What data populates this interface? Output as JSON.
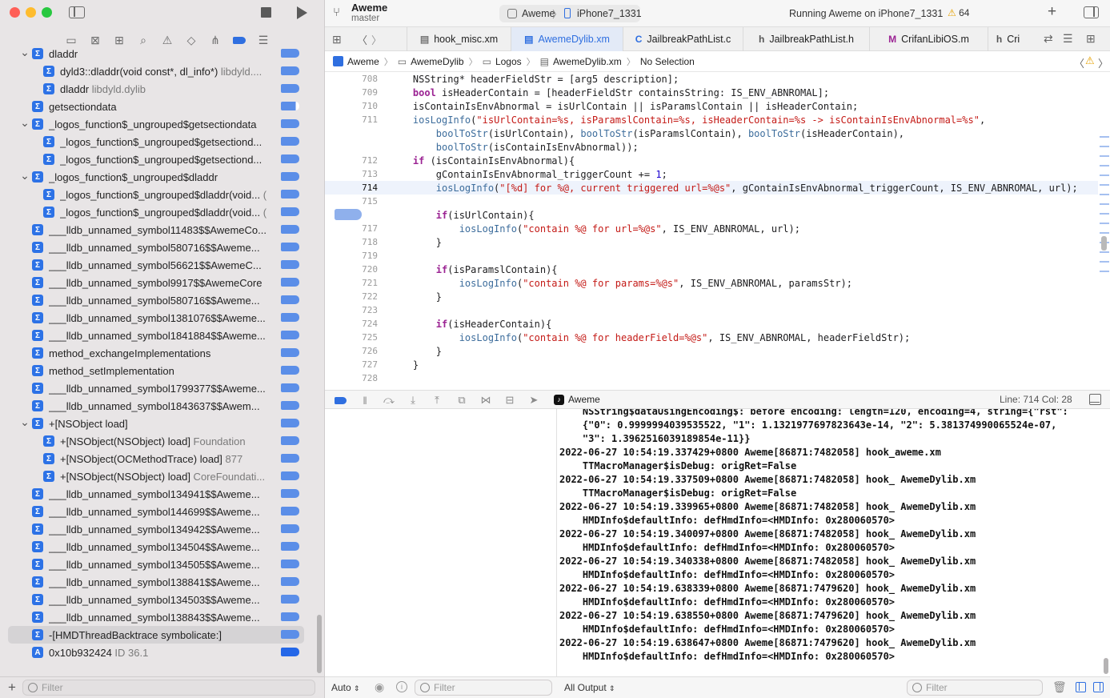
{
  "window": {
    "project_name": "Aweme",
    "branch": "master",
    "scheme": "Aweme",
    "device": "iPhone7_1331",
    "status": "Running Aweme on iPhone7_1331",
    "warning_count": "64"
  },
  "sidebar": {
    "filter_placeholder": "Filter",
    "items": [
      {
        "label": "dladdr",
        "sub": "",
        "disclosure": "v",
        "level": 0
      },
      {
        "label": "dyld3::dladdr(void const*, dl_info*)",
        "sub": "libdyld....",
        "disclosure": "",
        "level": 1
      },
      {
        "label": "dladdr",
        "sub": "libdyld.dylib",
        "disclosure": "",
        "level": 1
      },
      {
        "label": "getsectiondata",
        "sub": "",
        "disclosure": "",
        "level": 0
      },
      {
        "label": "_logos_function$_ungrouped$getsectiondata",
        "sub": "",
        "disclosure": "v",
        "level": 0
      },
      {
        "label": "_logos_function$_ungrouped$getsectiond...",
        "sub": "",
        "disclosure": "",
        "level": 1
      },
      {
        "label": "_logos_function$_ungrouped$getsectiond...",
        "sub": "",
        "disclosure": "",
        "level": 1
      },
      {
        "label": "_logos_function$_ungrouped$dladdr",
        "sub": "",
        "disclosure": "v",
        "level": 0
      },
      {
        "label": "_logos_function$_ungrouped$dladdr(void...",
        "sub": "(",
        "disclosure": "",
        "level": 1
      },
      {
        "label": "_logos_function$_ungrouped$dladdr(void...",
        "sub": "(",
        "disclosure": "",
        "level": 1
      },
      {
        "label": "___lldb_unnamed_symbol11483$$AwemeCo...",
        "sub": "",
        "disclosure": "",
        "level": 0
      },
      {
        "label": "___lldb_unnamed_symbol580716$$Aweme...",
        "sub": "",
        "disclosure": "",
        "level": 0
      },
      {
        "label": "___lldb_unnamed_symbol56621$$AwemeC...",
        "sub": "",
        "disclosure": "",
        "level": 0
      },
      {
        "label": "___lldb_unnamed_symbol9917$$AwemeCore",
        "sub": "",
        "disclosure": "",
        "level": 0
      },
      {
        "label": "___lldb_unnamed_symbol580716$$Aweme...",
        "sub": "",
        "disclosure": "",
        "level": 0
      },
      {
        "label": "___lldb_unnamed_symbol1381076$$Aweme...",
        "sub": "",
        "disclosure": "",
        "level": 0
      },
      {
        "label": "___lldb_unnamed_symbol1841884$$Aweme...",
        "sub": "",
        "disclosure": "",
        "level": 0
      },
      {
        "label": "method_exchangeImplementations",
        "sub": "",
        "disclosure": "",
        "level": 0
      },
      {
        "label": "method_setImplementation",
        "sub": "",
        "disclosure": "",
        "level": 0
      },
      {
        "label": "___lldb_unnamed_symbol1799377$$Aweme...",
        "sub": "",
        "disclosure": "",
        "level": 0
      },
      {
        "label": "___lldb_unnamed_symbol1843637$$Awem...",
        "sub": "",
        "disclosure": "",
        "level": 0
      },
      {
        "label": "+[NSObject load]",
        "sub": "",
        "disclosure": "v",
        "level": 0
      },
      {
        "label": "+[NSObject(NSObject) load]",
        "sub": "Foundation",
        "disclosure": "",
        "level": 1
      },
      {
        "label": "+[NSObject(OCMethodTrace) load]",
        "sub": "877",
        "disclosure": "",
        "level": 1
      },
      {
        "label": "+[NSObject(NSObject) load]",
        "sub": "CoreFoundati...",
        "disclosure": "",
        "level": 1
      },
      {
        "label": "___lldb_unnamed_symbol134941$$Aweme...",
        "sub": "",
        "disclosure": "",
        "level": 0
      },
      {
        "label": "___lldb_unnamed_symbol144699$$Aweme...",
        "sub": "",
        "disclosure": "",
        "level": 0
      },
      {
        "label": "___lldb_unnamed_symbol134942$$Aweme...",
        "sub": "",
        "disclosure": "",
        "level": 0
      },
      {
        "label": "___lldb_unnamed_symbol134504$$Aweme...",
        "sub": "",
        "disclosure": "",
        "level": 0
      },
      {
        "label": "___lldb_unnamed_symbol134505$$Aweme...",
        "sub": "",
        "disclosure": "",
        "level": 0
      },
      {
        "label": "___lldb_unnamed_symbol138841$$Aweme...",
        "sub": "",
        "disclosure": "",
        "level": 0
      },
      {
        "label": "___lldb_unnamed_symbol134503$$Aweme...",
        "sub": "",
        "disclosure": "",
        "level": 0
      },
      {
        "label": "___lldb_unnamed_symbol138843$$Aweme...",
        "sub": "",
        "disclosure": "",
        "level": 0
      },
      {
        "label": "-[HMDThreadBacktrace symbolicate:]",
        "sub": "",
        "disclosure": "",
        "level": 0
      },
      {
        "label": "0x10b932424",
        "sub": "ID 36.1",
        "disclosure": "",
        "level": 0
      }
    ]
  },
  "tabs": [
    {
      "label": "hook_misc.xm",
      "icon": "doc-icon"
    },
    {
      "label": "AwemeDylib.xm",
      "icon": "doc-icon"
    },
    {
      "label": "JailbreakPathList.c",
      "icon": "c-icon"
    },
    {
      "label": "JailbreakPathList.h",
      "icon": "h-icon"
    },
    {
      "label": "CrifanLibiOS.m",
      "icon": "m-icon"
    },
    {
      "label": "Cri",
      "icon": "h-icon"
    }
  ],
  "breadcrumb": [
    "Aweme",
    "AwemeDylib",
    "Logos",
    "AwemeDylib.xm",
    "No Selection"
  ],
  "editor": {
    "lines": [
      {
        "n": "708",
        "text": "    NSString* headerFieldStr = [arg5 description];"
      },
      {
        "n": "709",
        "text": "    bool isHeaderContain = [headerFieldStr containsString: IS_ENV_ABNROMAL];"
      },
      {
        "n": "710",
        "text": "    isContainIsEnvAbnormal = isUrlContain || isParamslContain || isHeaderContain;"
      },
      {
        "n": "711",
        "text": "    iosLogInfo(\"isUrlContain=%s, isParamslContain=%s, isHeaderContain=%s -> isContainIsEnvAbnormal=%s\","
      },
      {
        "n": "",
        "text": "        boolToStr(isUrlContain), boolToStr(isParamslContain), boolToStr(isHeaderContain),"
      },
      {
        "n": "",
        "text": "        boolToStr(isContainIsEnvAbnormal));"
      },
      {
        "n": "712",
        "text": "    if (isContainIsEnvAbnormal){"
      },
      {
        "n": "713",
        "text": "        gContainIsEnvAbnormal_triggerCount += 1;"
      },
      {
        "n": "714",
        "text": "        iosLogInfo(\"[%d] for %@, current triggered url=%@s\", gContainIsEnvAbnormal_triggerCount, IS_ENV_ABNROMAL, url);"
      },
      {
        "n": "715",
        "text": ""
      },
      {
        "n": "716",
        "text": "        if(isUrlContain){"
      },
      {
        "n": "717",
        "text": "            iosLogInfo(\"contain %@ for url=%@s\", IS_ENV_ABNROMAL, url);"
      },
      {
        "n": "718",
        "text": "        }"
      },
      {
        "n": "719",
        "text": ""
      },
      {
        "n": "720",
        "text": "        if(isParamslContain){"
      },
      {
        "n": "721",
        "text": "            iosLogInfo(\"contain %@ for params=%@s\", IS_ENV_ABNROMAL, paramsStr);"
      },
      {
        "n": "722",
        "text": "        }"
      },
      {
        "n": "723",
        "text": ""
      },
      {
        "n": "724",
        "text": "        if(isHeaderContain){"
      },
      {
        "n": "725",
        "text": "            iosLogInfo(\"contain %@ for headerField=%@s\", IS_ENV_ABNROMAL, headerFieldStr);"
      },
      {
        "n": "726",
        "text": "        }"
      },
      {
        "n": "727",
        "text": "    }"
      },
      {
        "n": "728",
        "text": ""
      }
    ]
  },
  "debug": {
    "process": "Aweme",
    "position": "Line: 714  Col: 28"
  },
  "console": {
    "lines": [
      "    NSString$dataUsingEncoding$: before encoding: length=120, encoding=4, string={\"rst\":",
      "    {\"0\": 0.9999994039535522, \"1\": 1.1321977697823643e-14, \"2\": 5.381374990065524e-07,",
      "    \"3\": 1.3962516039189854e-11}}",
      "2022-06-27 10:54:19.337429+0800 Aweme[86871:7482058] hook_aweme.xm",
      "    TTMacroManager$isDebug: origRet=False",
      "2022-06-27 10:54:19.337509+0800 Aweme[86871:7482058] hook_ AwemeDylib.xm",
      "    TTMacroManager$isDebug: origRet=False",
      "2022-06-27 10:54:19.339965+0800 Aweme[86871:7482058] hook_ AwemeDylib.xm",
      "    HMDInfo$defaultInfo: defHmdInfo=<HMDInfo: 0x280060570>",
      "2022-06-27 10:54:19.340097+0800 Aweme[86871:7482058] hook_ AwemeDylib.xm",
      "    HMDInfo$defaultInfo: defHmdInfo=<HMDInfo: 0x280060570>",
      "2022-06-27 10:54:19.340338+0800 Aweme[86871:7482058] hook_ AwemeDylib.xm",
      "    HMDInfo$defaultInfo: defHmdInfo=<HMDInfo: 0x280060570>",
      "2022-06-27 10:54:19.638339+0800 Aweme[86871:7479620] hook_ AwemeDylib.xm",
      "    HMDInfo$defaultInfo: defHmdInfo=<HMDInfo: 0x280060570>",
      "2022-06-27 10:54:19.638550+0800 Aweme[86871:7479620] hook_ AwemeDylib.xm",
      "    HMDInfo$defaultInfo: defHmdInfo=<HMDInfo: 0x280060570>",
      "2022-06-27 10:54:19.638647+0800 Aweme[86871:7479620] hook_ AwemeDylib.xm",
      "    HMDInfo$defaultInfo: defHmdInfo=<HMDInfo: 0x280060570>"
    ]
  },
  "bottombar": {
    "auto_label": "Auto",
    "vars_filter_placeholder": "Filter",
    "output_label": "All Output",
    "console_filter_placeholder": "Filter"
  },
  "colors": {
    "accent": "#2f6fe0",
    "breakpoint": "#5b8ee8",
    "string": "#c41a16",
    "keyword": "#9b2393",
    "function": "#3d6d9c",
    "warning": "#e6a100"
  }
}
